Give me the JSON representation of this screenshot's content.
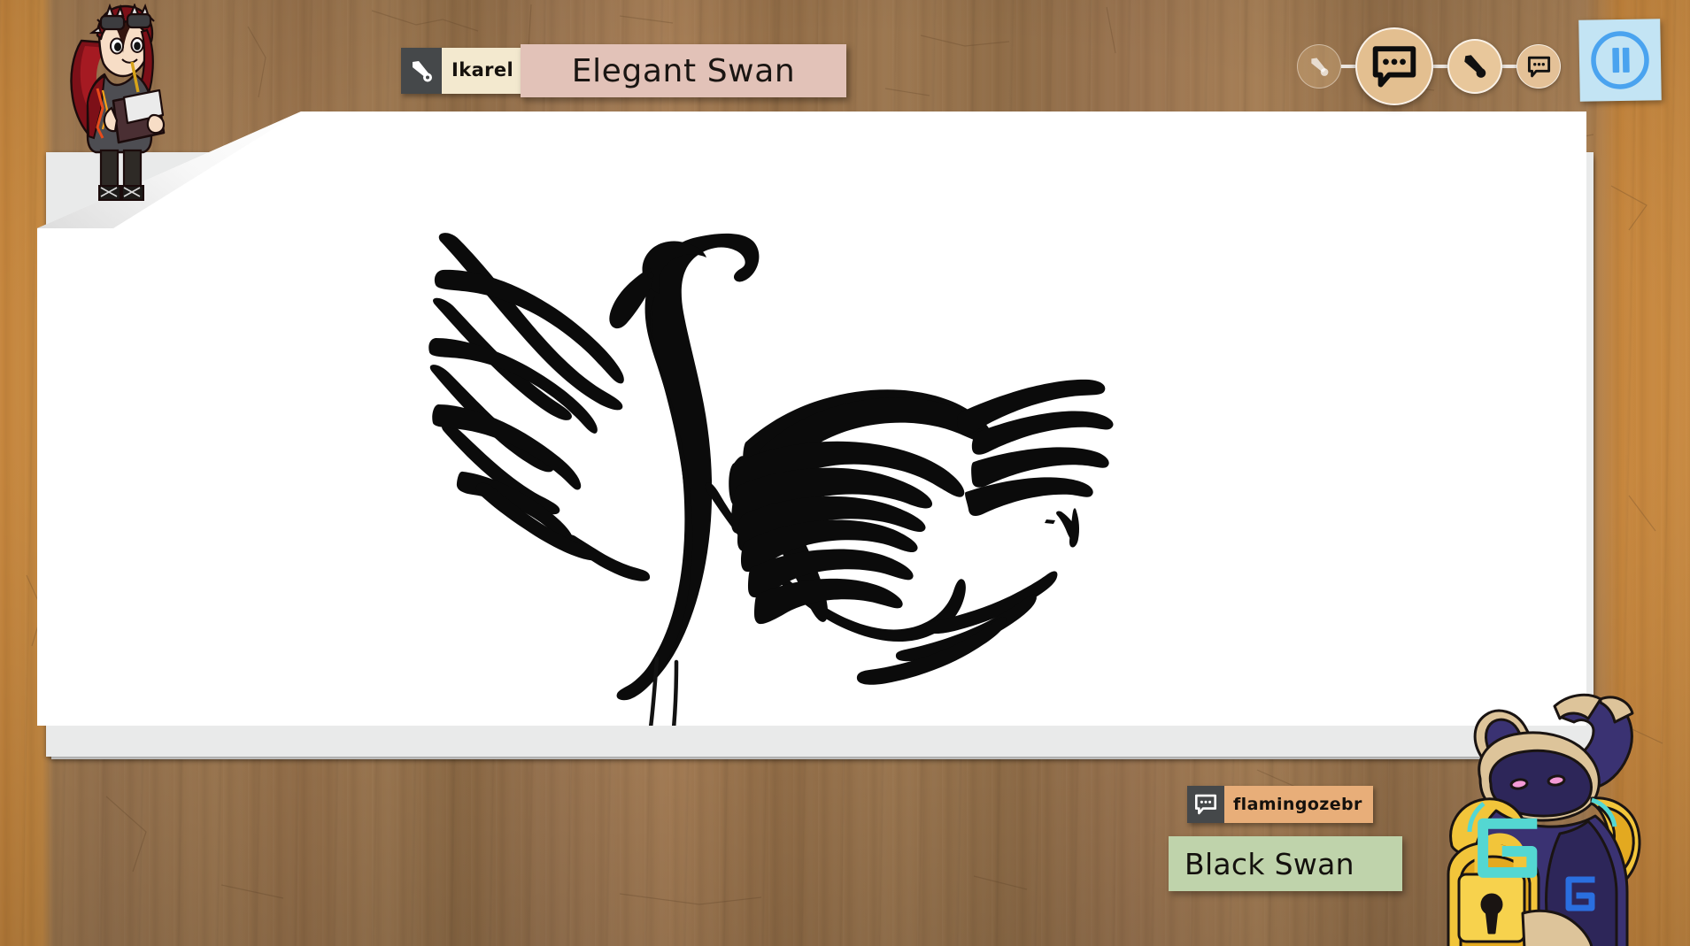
{
  "game": {
    "background": "wood-desk",
    "wood_color": "#9a7550",
    "wood_edge_color": "#c6863d"
  },
  "drawer": {
    "name": "Ikarel",
    "icon": "paintbrush-icon",
    "icon_bg": "#45484a",
    "label_bg": "#f3e9cf",
    "avatar": "punk-girl-with-goggles-and-sketchbook-avatar"
  },
  "prompt": {
    "word": "Elegant Swan",
    "bg": "#e2c2b8",
    "text_color": "#1a1512"
  },
  "turn_indicator": {
    "nodes": [
      {
        "state": "done",
        "icon": "paintbrush-icon"
      },
      {
        "state": "active",
        "icon": "chat-bubble-icon"
      },
      {
        "state": "next",
        "icon": "paintbrush-icon"
      },
      {
        "state": "future",
        "icon": "chat-bubble-icon"
      }
    ],
    "node_bg": "#e3bf90"
  },
  "pause_button": {
    "label": "Pause",
    "icon": "pause-icon",
    "bg": "#c3e4f4",
    "icon_color": "#4aa3ef"
  },
  "canvas": {
    "drawing_title": "black swan sketch",
    "paper_color": "#ffffff",
    "cursor": "arrow-cursor"
  },
  "guess": {
    "player": "flamingozebr",
    "icon": "chat-bubble-icon",
    "icon_bg": "#45484a",
    "name_bg": "#e8ae79",
    "text": "Black Swan",
    "bubble_bg": "#bfd3ab",
    "avatar": "armored-golden-knight-avatar"
  }
}
